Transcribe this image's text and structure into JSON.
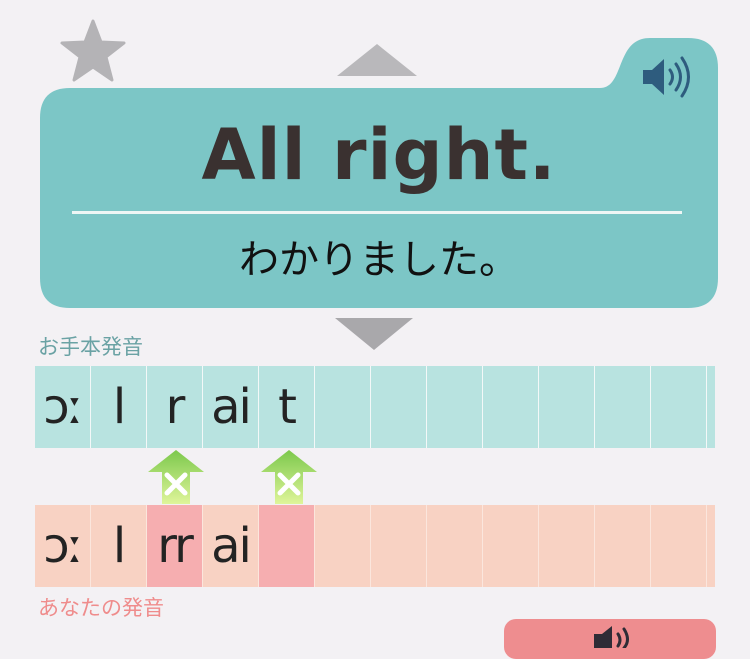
{
  "phrase": {
    "english": "All right.",
    "japanese": "わかりました。"
  },
  "labels": {
    "model": "お手本発音",
    "yours": "あなたの発音"
  },
  "model_phonemes": [
    "ɔː",
    "l",
    "r",
    "ai",
    "t",
    "",
    "",
    "",
    "",
    "",
    "",
    ""
  ],
  "your_phonemes": [
    {
      "text": "ɔː",
      "error": false
    },
    {
      "text": "l",
      "error": false
    },
    {
      "text": "rr",
      "error": true
    },
    {
      "text": "ai",
      "error": false
    },
    {
      "text": "",
      "error": true
    },
    {
      "text": "",
      "error": false
    },
    {
      "text": "",
      "error": false
    },
    {
      "text": "",
      "error": false
    },
    {
      "text": "",
      "error": false
    },
    {
      "text": "",
      "error": false
    },
    {
      "text": "",
      "error": false
    },
    {
      "text": "",
      "error": false
    }
  ],
  "colors": {
    "card": "#7cc6c6",
    "model_row": "#b8e3e0",
    "your_row": "#f8d2c3",
    "error_cell": "#f6aeb0",
    "marker_green": "#8cd05a",
    "speaker": "#2e5c7e"
  },
  "icons": {
    "star": "star-icon",
    "prev": "triangle-up-icon",
    "next": "triangle-down-icon",
    "speaker": "speaker-icon",
    "error": "x-mark-icon"
  }
}
